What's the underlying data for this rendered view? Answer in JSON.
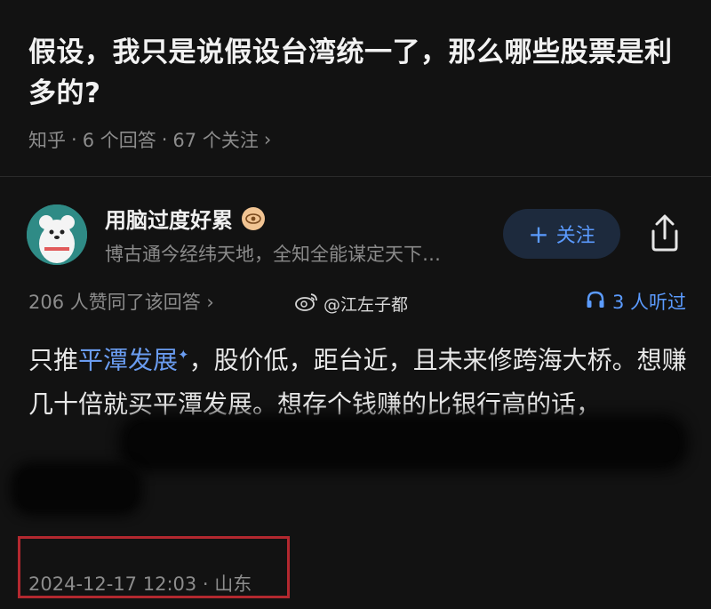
{
  "question": {
    "title": "假设，我只是说假设台湾统一了，那么哪些股票是利多的?",
    "source": "知乎",
    "answers": "6 个回答",
    "followers": "67 个关注",
    "chevron": "›"
  },
  "author": {
    "name": "用脑过度好累",
    "bio": "博古通今经纬天地，全知全能谋定天下…",
    "badge_icon": "eye-badge-icon",
    "follow_label": "关注",
    "follow_plus": "+"
  },
  "stats": {
    "approvals": "206 人赞同了该回答 ›",
    "watermark": "@江左子都",
    "listeners": "3 人听过"
  },
  "answer": {
    "prefix": "只推",
    "link_text": "平潭发展",
    "rest": "，股价低，距台近，且未来修跨海大桥。想赚几十倍就买平潭发展。想存个钱赚的比银行高的话，"
  },
  "footer": {
    "timestamp": "2024-12-17 12:03 · 山东"
  },
  "colors": {
    "background": "#121212",
    "accent": "#5b9bff",
    "highlight_box": "#b3282f"
  }
}
